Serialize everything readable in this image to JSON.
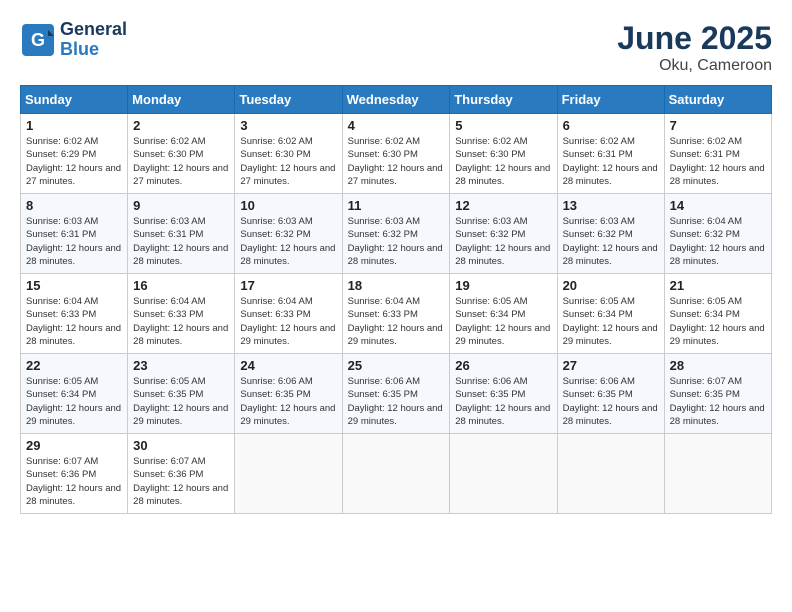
{
  "header": {
    "logo_line1": "General",
    "logo_line2": "Blue",
    "month": "June 2025",
    "location": "Oku, Cameroon"
  },
  "weekdays": [
    "Sunday",
    "Monday",
    "Tuesday",
    "Wednesday",
    "Thursday",
    "Friday",
    "Saturday"
  ],
  "weeks": [
    [
      {
        "day": "1",
        "sunrise": "Sunrise: 6:02 AM",
        "sunset": "Sunset: 6:29 PM",
        "daylight": "Daylight: 12 hours and 27 minutes."
      },
      {
        "day": "2",
        "sunrise": "Sunrise: 6:02 AM",
        "sunset": "Sunset: 6:30 PM",
        "daylight": "Daylight: 12 hours and 27 minutes."
      },
      {
        "day": "3",
        "sunrise": "Sunrise: 6:02 AM",
        "sunset": "Sunset: 6:30 PM",
        "daylight": "Daylight: 12 hours and 27 minutes."
      },
      {
        "day": "4",
        "sunrise": "Sunrise: 6:02 AM",
        "sunset": "Sunset: 6:30 PM",
        "daylight": "Daylight: 12 hours and 27 minutes."
      },
      {
        "day": "5",
        "sunrise": "Sunrise: 6:02 AM",
        "sunset": "Sunset: 6:30 PM",
        "daylight": "Daylight: 12 hours and 28 minutes."
      },
      {
        "day": "6",
        "sunrise": "Sunrise: 6:02 AM",
        "sunset": "Sunset: 6:31 PM",
        "daylight": "Daylight: 12 hours and 28 minutes."
      },
      {
        "day": "7",
        "sunrise": "Sunrise: 6:02 AM",
        "sunset": "Sunset: 6:31 PM",
        "daylight": "Daylight: 12 hours and 28 minutes."
      }
    ],
    [
      {
        "day": "8",
        "sunrise": "Sunrise: 6:03 AM",
        "sunset": "Sunset: 6:31 PM",
        "daylight": "Daylight: 12 hours and 28 minutes."
      },
      {
        "day": "9",
        "sunrise": "Sunrise: 6:03 AM",
        "sunset": "Sunset: 6:31 PM",
        "daylight": "Daylight: 12 hours and 28 minutes."
      },
      {
        "day": "10",
        "sunrise": "Sunrise: 6:03 AM",
        "sunset": "Sunset: 6:32 PM",
        "daylight": "Daylight: 12 hours and 28 minutes."
      },
      {
        "day": "11",
        "sunrise": "Sunrise: 6:03 AM",
        "sunset": "Sunset: 6:32 PM",
        "daylight": "Daylight: 12 hours and 28 minutes."
      },
      {
        "day": "12",
        "sunrise": "Sunrise: 6:03 AM",
        "sunset": "Sunset: 6:32 PM",
        "daylight": "Daylight: 12 hours and 28 minutes."
      },
      {
        "day": "13",
        "sunrise": "Sunrise: 6:03 AM",
        "sunset": "Sunset: 6:32 PM",
        "daylight": "Daylight: 12 hours and 28 minutes."
      },
      {
        "day": "14",
        "sunrise": "Sunrise: 6:04 AM",
        "sunset": "Sunset: 6:32 PM",
        "daylight": "Daylight: 12 hours and 28 minutes."
      }
    ],
    [
      {
        "day": "15",
        "sunrise": "Sunrise: 6:04 AM",
        "sunset": "Sunset: 6:33 PM",
        "daylight": "Daylight: 12 hours and 28 minutes."
      },
      {
        "day": "16",
        "sunrise": "Sunrise: 6:04 AM",
        "sunset": "Sunset: 6:33 PM",
        "daylight": "Daylight: 12 hours and 28 minutes."
      },
      {
        "day": "17",
        "sunrise": "Sunrise: 6:04 AM",
        "sunset": "Sunset: 6:33 PM",
        "daylight": "Daylight: 12 hours and 29 minutes."
      },
      {
        "day": "18",
        "sunrise": "Sunrise: 6:04 AM",
        "sunset": "Sunset: 6:33 PM",
        "daylight": "Daylight: 12 hours and 29 minutes."
      },
      {
        "day": "19",
        "sunrise": "Sunrise: 6:05 AM",
        "sunset": "Sunset: 6:34 PM",
        "daylight": "Daylight: 12 hours and 29 minutes."
      },
      {
        "day": "20",
        "sunrise": "Sunrise: 6:05 AM",
        "sunset": "Sunset: 6:34 PM",
        "daylight": "Daylight: 12 hours and 29 minutes."
      },
      {
        "day": "21",
        "sunrise": "Sunrise: 6:05 AM",
        "sunset": "Sunset: 6:34 PM",
        "daylight": "Daylight: 12 hours and 29 minutes."
      }
    ],
    [
      {
        "day": "22",
        "sunrise": "Sunrise: 6:05 AM",
        "sunset": "Sunset: 6:34 PM",
        "daylight": "Daylight: 12 hours and 29 minutes."
      },
      {
        "day": "23",
        "sunrise": "Sunrise: 6:05 AM",
        "sunset": "Sunset: 6:35 PM",
        "daylight": "Daylight: 12 hours and 29 minutes."
      },
      {
        "day": "24",
        "sunrise": "Sunrise: 6:06 AM",
        "sunset": "Sunset: 6:35 PM",
        "daylight": "Daylight: 12 hours and 29 minutes."
      },
      {
        "day": "25",
        "sunrise": "Sunrise: 6:06 AM",
        "sunset": "Sunset: 6:35 PM",
        "daylight": "Daylight: 12 hours and 29 minutes."
      },
      {
        "day": "26",
        "sunrise": "Sunrise: 6:06 AM",
        "sunset": "Sunset: 6:35 PM",
        "daylight": "Daylight: 12 hours and 28 minutes."
      },
      {
        "day": "27",
        "sunrise": "Sunrise: 6:06 AM",
        "sunset": "Sunset: 6:35 PM",
        "daylight": "Daylight: 12 hours and 28 minutes."
      },
      {
        "day": "28",
        "sunrise": "Sunrise: 6:07 AM",
        "sunset": "Sunset: 6:35 PM",
        "daylight": "Daylight: 12 hours and 28 minutes."
      }
    ],
    [
      {
        "day": "29",
        "sunrise": "Sunrise: 6:07 AM",
        "sunset": "Sunset: 6:36 PM",
        "daylight": "Daylight: 12 hours and 28 minutes."
      },
      {
        "day": "30",
        "sunrise": "Sunrise: 6:07 AM",
        "sunset": "Sunset: 6:36 PM",
        "daylight": "Daylight: 12 hours and 28 minutes."
      },
      null,
      null,
      null,
      null,
      null
    ]
  ]
}
